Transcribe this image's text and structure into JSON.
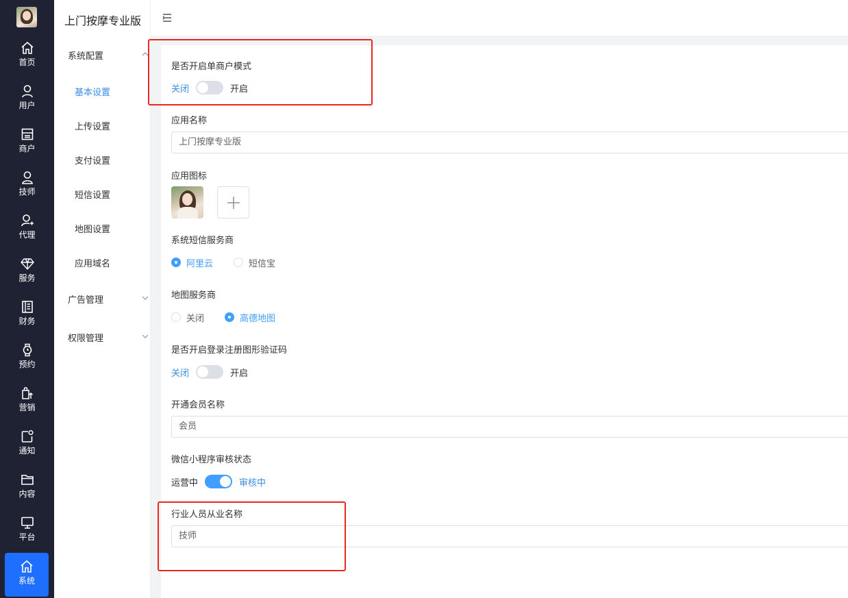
{
  "app": {
    "brand": "上门按摩专业版"
  },
  "rail": {
    "items": [
      {
        "label": "首页",
        "icon": "home-icon"
      },
      {
        "label": "用户",
        "icon": "user-icon"
      },
      {
        "label": "商户",
        "icon": "store-icon"
      },
      {
        "label": "技师",
        "icon": "technician-icon"
      },
      {
        "label": "代理",
        "icon": "agent-icon"
      },
      {
        "label": "服务",
        "icon": "diamond-icon"
      },
      {
        "label": "财务",
        "icon": "ledger-icon"
      },
      {
        "label": "预约",
        "icon": "watch-icon"
      },
      {
        "label": "营销",
        "icon": "bag-icon"
      },
      {
        "label": "通知",
        "icon": "notification-icon"
      },
      {
        "label": "内容",
        "icon": "folder-icon"
      },
      {
        "label": "平台",
        "icon": "monitor-icon"
      },
      {
        "label": "系统",
        "icon": "home-icon",
        "active": true
      }
    ]
  },
  "submenu": {
    "groups": [
      {
        "label": "系统配置",
        "expanded": true
      },
      {
        "label": "广告管理",
        "expanded": false
      },
      {
        "label": "权限管理",
        "expanded": false
      }
    ],
    "items": [
      "基本设置",
      "上传设置",
      "支付设置",
      "短信设置",
      "地图设置",
      "应用域名"
    ],
    "active_item": "基本设置"
  },
  "form": {
    "single_merchant": {
      "label": "是否开启单商户模式",
      "off_text": "关闭",
      "on_text": "开启",
      "checked": false
    },
    "app_name": {
      "label": "应用名称",
      "value": "上门按摩专业版"
    },
    "app_icon": {
      "label": "应用图标"
    },
    "sms_provider": {
      "label": "系统短信服务商",
      "options": [
        "阿里云",
        "短信宝"
      ],
      "selected": "阿里云"
    },
    "map_provider": {
      "label": "地图服务商",
      "options": [
        "关闭",
        "高德地图"
      ],
      "selected": "高德地图"
    },
    "captcha": {
      "label": "是否开启登录注册图形验证码",
      "off_text": "关闭",
      "on_text": "开启",
      "checked": false
    },
    "member_name": {
      "label": "开通会员名称",
      "value": "会员"
    },
    "wechat_review": {
      "label": "微信小程序审核状态",
      "off_text": "运营中",
      "on_text": "审核中",
      "checked": true
    },
    "staff_title": {
      "label": "行业人员从业名称",
      "value": "技师"
    }
  },
  "colors": {
    "accent": "#409eff",
    "rail_bg": "#1f2233",
    "rail_active": "#1e6fff",
    "highlight": "#e8281e"
  }
}
